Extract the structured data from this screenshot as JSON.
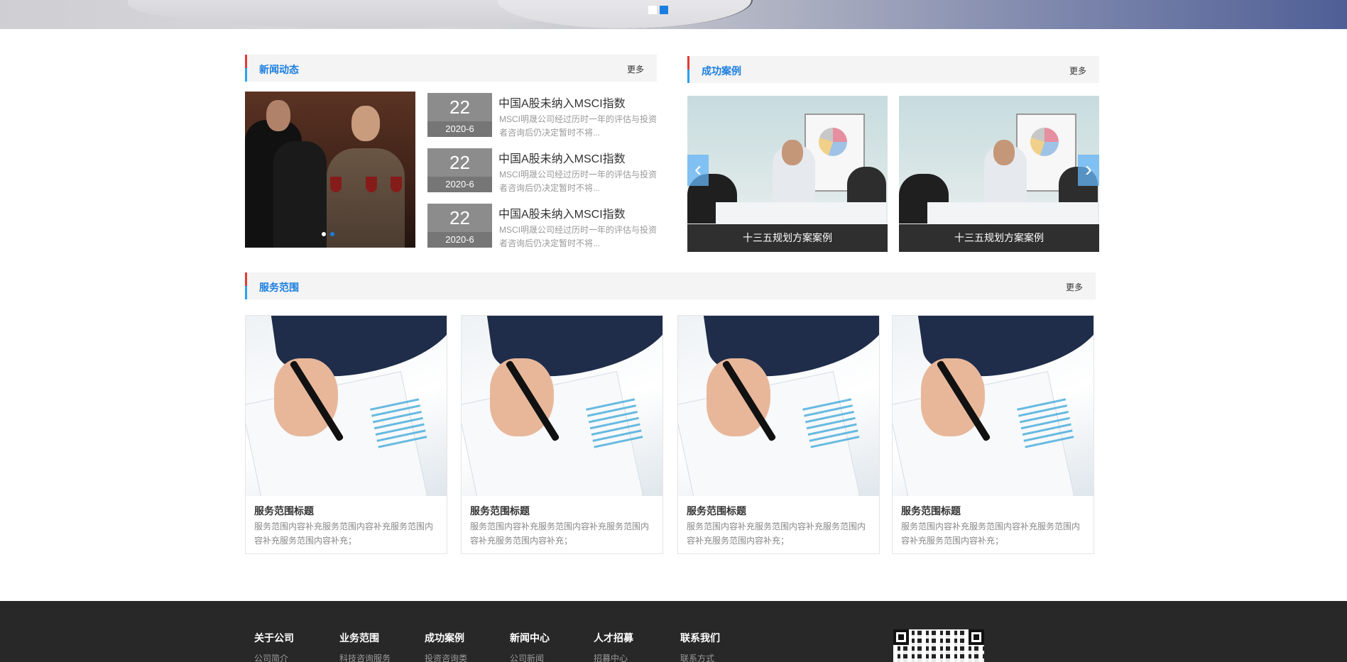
{
  "banner": {
    "slides": [
      {
        "active": false
      },
      {
        "active": true
      }
    ]
  },
  "news": {
    "title": "新闻动态",
    "more": "更多",
    "items": [
      {
        "day": "22",
        "ym": "2020-6",
        "title": "中国A股未纳入MSCI指数",
        "desc": "MSCI明晟公司经过历时一年的评估与投资者咨询后仍决定暂时不将..."
      },
      {
        "day": "22",
        "ym": "2020-6",
        "title": "中国A股未纳入MSCI指数",
        "desc": "MSCI明晟公司经过历时一年的评估与投资者咨询后仍决定暂时不将..."
      },
      {
        "day": "22",
        "ym": "2020-6",
        "title": "中国A股未纳入MSCI指数",
        "desc": "MSCI明晟公司经过历时一年的评估与投资者咨询后仍决定暂时不将..."
      }
    ]
  },
  "cases": {
    "title": "成功案例",
    "more": "更多",
    "items": [
      {
        "caption": "十三五规划方案案例"
      },
      {
        "caption": "十三五规划方案案例"
      }
    ],
    "prev_icon": "chevron-left-icon",
    "next_icon": "chevron-right-icon"
  },
  "services": {
    "title": "服务范围",
    "more": "更多",
    "items": [
      {
        "title": "服务范围标题",
        "desc": "服务范围内容补充服务范围内容补充服务范围内容补充服务范围内容补充；"
      },
      {
        "title": "服务范围标题",
        "desc": "服务范围内容补充服务范围内容补充服务范围内容补充服务范围内容补充；"
      },
      {
        "title": "服务范围标题",
        "desc": "服务范围内容补充服务范围内容补充服务范围内容补充服务范围内容补充；"
      },
      {
        "title": "服务范围标题",
        "desc": "服务范围内容补充服务范围内容补充服务范围内容补充服务范围内容补充；"
      }
    ]
  },
  "footer": {
    "columns": [
      {
        "head": "关于公司",
        "link": "公司简介"
      },
      {
        "head": "业务范围",
        "link": "科技咨询服务"
      },
      {
        "head": "成功案例",
        "link": "投资咨询类"
      },
      {
        "head": "新闻中心",
        "link": "公司新闻"
      },
      {
        "head": "人才招募",
        "link": "招募中心"
      },
      {
        "head": "联系我们",
        "link": "联系方式"
      }
    ],
    "qr_icon": "qr-code-icon"
  },
  "colors": {
    "accent": "#1a7ee0",
    "section_bar": "#f4f4f4",
    "date_box": "#8c8c8c",
    "caption_bg": "#2f2f2f",
    "footer_bg": "#282828"
  }
}
